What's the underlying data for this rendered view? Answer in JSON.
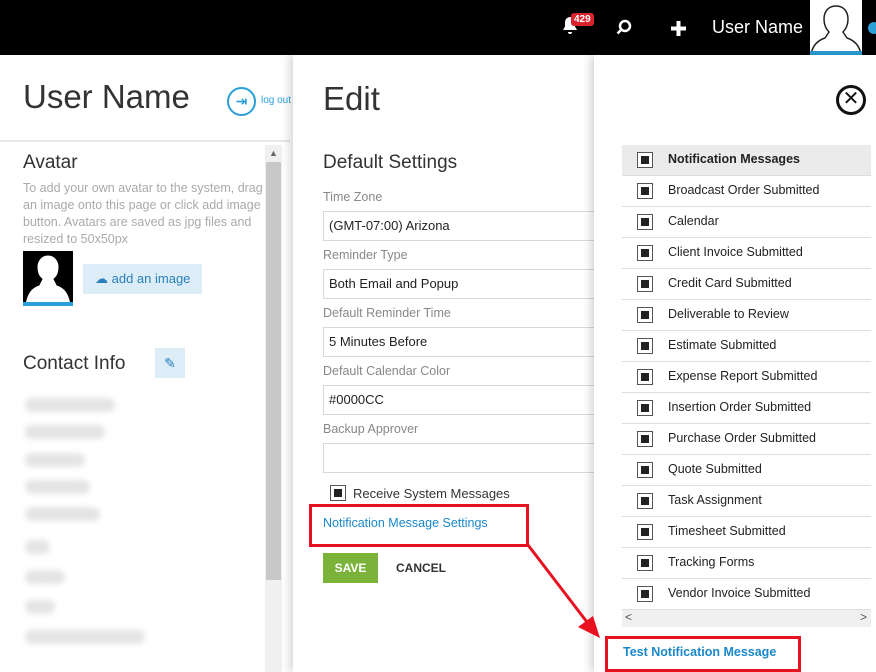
{
  "topbar": {
    "badge_count": "429",
    "username": "User Name",
    "icons": [
      "bell-icon",
      "search-icon",
      "plus-icon"
    ]
  },
  "left": {
    "title": "User Name",
    "logout_label": "log out",
    "avatar_heading": "Avatar",
    "avatar_desc": "To add your own avatar to the system, drag an image onto this page or click add image button. Avatars are saved as jpg files and resized to 50x50px",
    "add_image_label": "add an image",
    "contact_heading": "Contact Info"
  },
  "edit": {
    "title": "Edit",
    "section": "Default Settings",
    "fields": [
      {
        "label": "Time Zone",
        "value": "(GMT-07:00) Arizona"
      },
      {
        "label": "Reminder Type",
        "value": "Both Email and Popup"
      },
      {
        "label": "Default Reminder Time",
        "value": "5 Minutes Before"
      },
      {
        "label": "Default Calendar Color",
        "value": "#0000CC"
      },
      {
        "label": "Backup Approver",
        "value": ""
      }
    ],
    "receive_system_messages": "Receive System Messages",
    "notif_settings_link": "Notification Message Settings",
    "save_label": "SAVE",
    "cancel_label": "CANCEL"
  },
  "notifications": {
    "header": "Notification Messages",
    "items": [
      "Broadcast Order Submitted",
      "Calendar",
      "Client Invoice Submitted",
      "Credit Card Submitted",
      "Deliverable to Review",
      "Estimate Submitted",
      "Expense Report Submitted",
      "Insertion Order Submitted",
      "Purchase Order Submitted",
      "Quote Submitted",
      "Task Assignment",
      "Timesheet Submitted",
      "Tracking Forms",
      "Vendor Invoice Submitted"
    ],
    "test_link": "Test Notification Message"
  },
  "colors": {
    "accent": "#2a9fd8",
    "link": "#1a88c9",
    "save": "#7ab23a",
    "highlight": "#e8111f"
  }
}
